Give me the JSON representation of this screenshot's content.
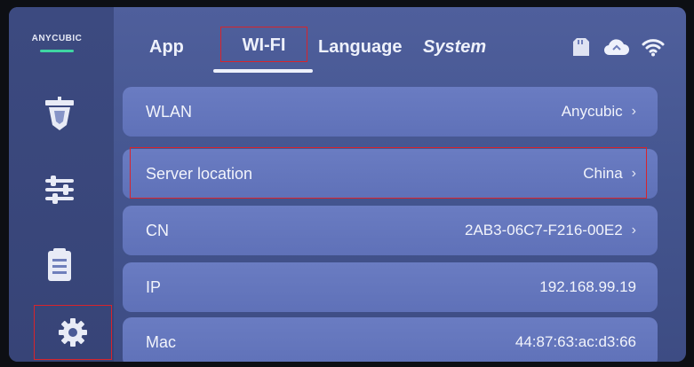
{
  "brand": {
    "logo_text": "ANYCUBIC"
  },
  "tabs": [
    {
      "label": "App"
    },
    {
      "label": "WI-FI"
    },
    {
      "label": "Language"
    },
    {
      "label": "System"
    }
  ],
  "status_icons": [
    "sd-card-icon",
    "cloud-icon",
    "wifi-icon"
  ],
  "sidebar": {
    "items": [
      {
        "icon": "print-icon"
      },
      {
        "icon": "sliders-icon"
      },
      {
        "icon": "file-list-icon"
      },
      {
        "icon": "gear-icon"
      }
    ]
  },
  "rows": [
    {
      "label": "WLAN",
      "value": "Anycubic"
    },
    {
      "label": "Server location",
      "value": "China"
    },
    {
      "label": "CN",
      "value": "2AB3-06C7-F216-00E2"
    },
    {
      "label": "IP",
      "value": "192.168.99.19"
    },
    {
      "label": "Mac",
      "value": "44:87:63:ac:d3:66"
    }
  ],
  "chevron": "›",
  "colors": {
    "accent": "#3fd6a3",
    "highlight_box": "#d8242c"
  }
}
